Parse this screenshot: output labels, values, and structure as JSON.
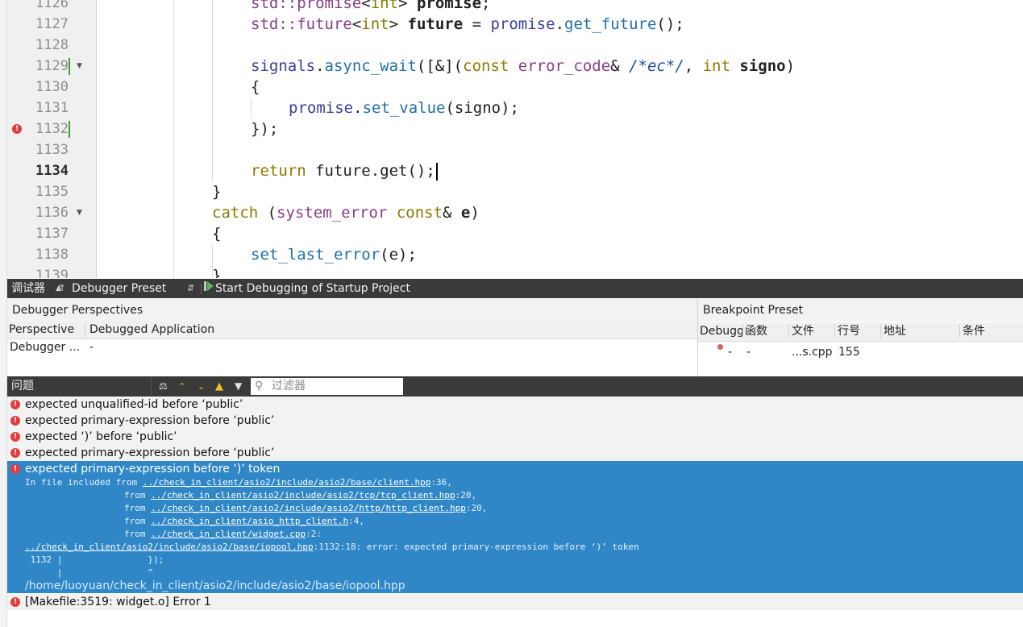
{
  "editor": {
    "lines": [
      {
        "n": "1126"
      },
      {
        "n": "1127"
      },
      {
        "n": "1128"
      },
      {
        "n": "1129"
      },
      {
        "n": "1130"
      },
      {
        "n": "1131"
      },
      {
        "n": "1132"
      },
      {
        "n": "1133"
      },
      {
        "n": "1134"
      },
      {
        "n": "1135"
      },
      {
        "n": "1136"
      },
      {
        "n": "1137"
      },
      {
        "n": "1138"
      },
      {
        "n": "1139"
      }
    ],
    "code": {
      "l1126_a": "std::",
      "l1126_b": "promise",
      "l1126_c": "<",
      "l1126_d": "int",
      "l1126_e": "> ",
      "l1126_f": "promise",
      "l1126_g": ";",
      "l1127_a": "std::",
      "l1127_b": "future",
      "l1127_c": "<",
      "l1127_d": "int",
      "l1127_e": "> ",
      "l1127_f": "future",
      "l1127_g": " = ",
      "l1127_h": "promise",
      "l1127_i": ".",
      "l1127_j": "get_future",
      "l1127_k": "();",
      "l1129_a": "signals",
      "l1129_b": ".",
      "l1129_c": "async_wait",
      "l1129_d": "([&](",
      "l1129_e": "const",
      "l1129_f": " ",
      "l1129_g": "error_code",
      "l1129_h": "& ",
      "l1129_i": "/*ec*/",
      "l1129_j": ", ",
      "l1129_k": "int",
      "l1129_l": " ",
      "l1129_m": "signo",
      "l1129_n": ")",
      "l1130": "{",
      "l1131_a": "promise",
      "l1131_b": ".",
      "l1131_c": "set_value",
      "l1131_d": "(signo);",
      "l1132": "});",
      "l1134_a": "return",
      "l1134_b": " future.get();",
      "l1135": "}",
      "l1136_a": "catch",
      "l1136_b": " (",
      "l1136_c": "system_error",
      "l1136_d": " ",
      "l1136_e": "const",
      "l1136_f": "& ",
      "l1136_g": "e",
      "l1136_h": ")",
      "l1137": "{",
      "l1138_a": "set_last_error",
      "l1138_b": "(e);",
      "l1139": "}"
    }
  },
  "debugger_bar": {
    "title": "调试器",
    "preset": "Debugger Preset",
    "start": "Start Debugging of Startup Project"
  },
  "perspectives": {
    "title": "Debugger Perspectives",
    "col1": "Perspective",
    "col2": "Debugged Application",
    "row_perspective": "Debugger ...",
    "row_app": "-"
  },
  "breakpoints": {
    "title": "Breakpoint Preset",
    "cols": [
      "Debugg",
      "函数",
      "文件",
      "行号",
      "地址",
      "条件"
    ],
    "row": {
      "debugger": "-",
      "function": "-",
      "file": "...s.cpp",
      "line": "155"
    }
  },
  "issues_bar": {
    "title": "问题",
    "filter_placeholder": "过滤器"
  },
  "issues": [
    {
      "text": "expected unqualified-id before ‘public’"
    },
    {
      "text": "expected primary-expression before ‘public’"
    },
    {
      "text": "expected ‘)’ before ‘public’"
    },
    {
      "text": "expected primary-expression before ‘public’"
    }
  ],
  "selected_issue": {
    "text": "expected primary-expression before ‘)’ token",
    "l1_prefix": "In file included from ",
    "l1_link": "../check_in_client/asio2/include/asio2/base/client.hpp",
    "l1_suffix": ":36,",
    "l2_prefix": "from ",
    "l2_link": "../check_in_client/asio2/include/asio2/tcp/tcp_client.hpp",
    "l2_suffix": ":20,",
    "l3_prefix": "from ",
    "l3_link": "../check_in_client/asio2/include/asio2/http/http_client.hpp",
    "l3_suffix": ":20,",
    "l4_prefix": "from ",
    "l4_link": "../check_in_client/asio_http_client.h",
    "l4_suffix": ":4,",
    "l5_prefix": "from ",
    "l5_link": "../check_in_client/widget.cpp",
    "l5_suffix": ":2:",
    "l6_link": "../check_in_client/asio2/include/asio2/base/iopool.hpp",
    "l6_suffix": ":1132:18: error: expected primary-expression before ‘)’ token",
    "l7": " 1132 |                });",
    "l8": "      |                ^",
    "path": "/home/luoyuan/check_in_client/asio2/include/asio2/base/iopool.hpp"
  },
  "last_issue": {
    "text": "[Makefile:3519: widget.o] Error 1"
  }
}
